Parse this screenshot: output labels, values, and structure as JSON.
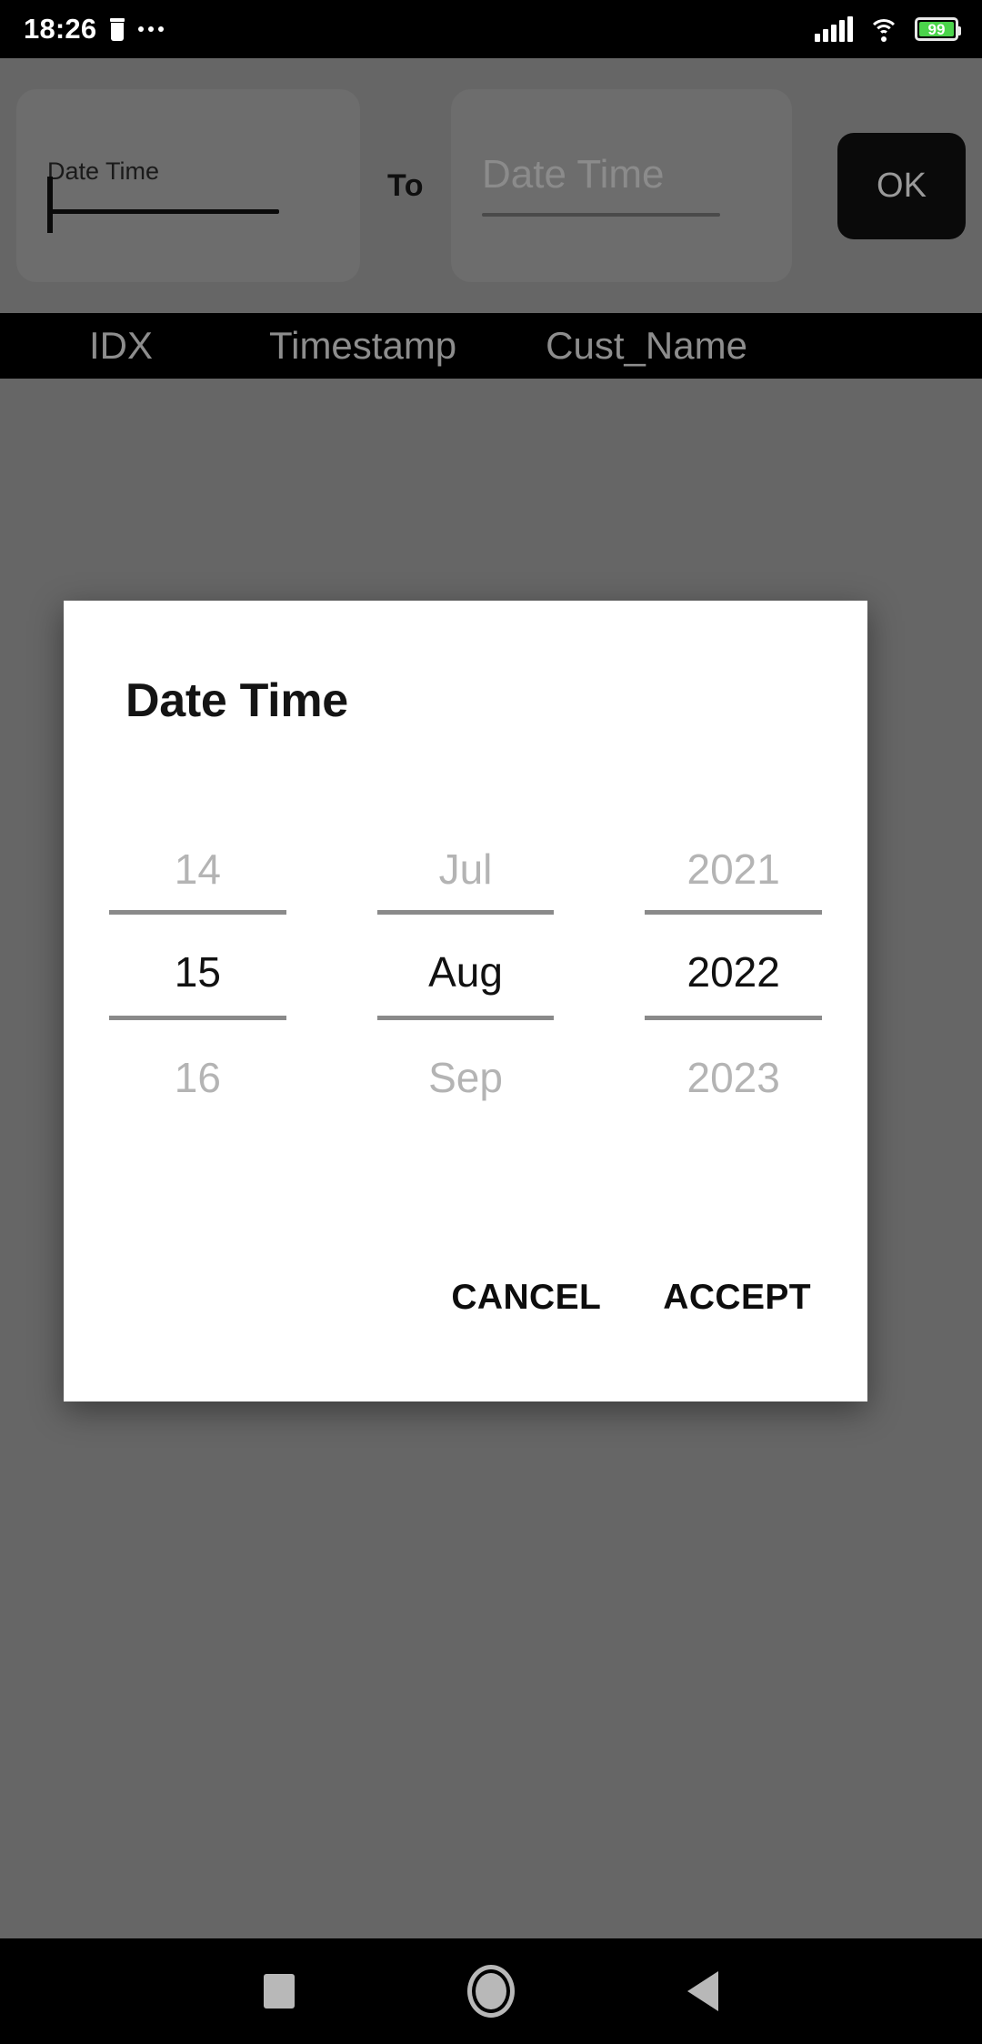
{
  "status_bar": {
    "time": "18:26",
    "trash_icon": "trash-icon",
    "overflow_icon": "more-dots-icon",
    "signal_icon": "signal-bars-icon",
    "wifi_icon": "wifi-icon",
    "battery_icon": "battery-icon",
    "battery_level": "99"
  },
  "filter_bar": {
    "from_field": {
      "label": "Date Time",
      "value": "",
      "placeholder": "Date Time",
      "focused": true
    },
    "separator_label": "To",
    "to_field": {
      "label": "Date Time",
      "value": "",
      "placeholder": "Date Time",
      "focused": false
    },
    "ok_button": "OK"
  },
  "table": {
    "columns": [
      "IDX",
      "Timestamp",
      "Cust_Name"
    ]
  },
  "dialog": {
    "title": "Date Time",
    "picker": {
      "columns": [
        {
          "name": "day",
          "previous": "14",
          "selected": "15",
          "next": "16"
        },
        {
          "name": "month",
          "previous": "Jul",
          "selected": "Aug",
          "next": "Sep"
        },
        {
          "name": "year",
          "previous": "2021",
          "selected": "2022",
          "next": "2023"
        }
      ]
    },
    "cancel_label": "CANCEL",
    "accept_label": "ACCEPT"
  },
  "nav_bar": {
    "recents_icon": "square-recents-icon",
    "home_icon": "circle-home-icon",
    "back_icon": "triangle-back-icon"
  },
  "colors": {
    "scrim": "#666666",
    "dialog_surface": "#ffffff",
    "bar_black": "#000000",
    "battery_green": "#4bd44b",
    "picker_inactive": "#b4b4b4",
    "picker_divider": "#8a8a8a"
  }
}
